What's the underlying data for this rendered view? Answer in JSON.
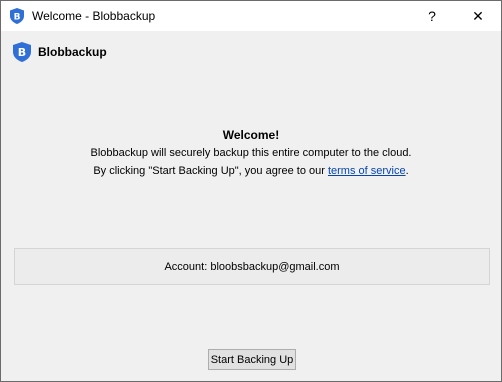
{
  "window": {
    "title": "Welcome - Blobbackup",
    "help_label": "?",
    "close_label": "✕"
  },
  "brand": {
    "name": "Blobbackup",
    "icon": "shield-b-icon",
    "icon_color": "#2f6fd6"
  },
  "welcome": {
    "heading": "Welcome!",
    "line1": "Blobbackup will securely backup this entire computer to the cloud.",
    "line2_prefix": "By clicking \"Start Backing Up\", you agree to our ",
    "tos_link": "terms of service",
    "line2_suffix": "."
  },
  "account": {
    "label": "Account: bloobsbackup@gmail.com"
  },
  "actions": {
    "start_label": "Start Backing Up"
  }
}
